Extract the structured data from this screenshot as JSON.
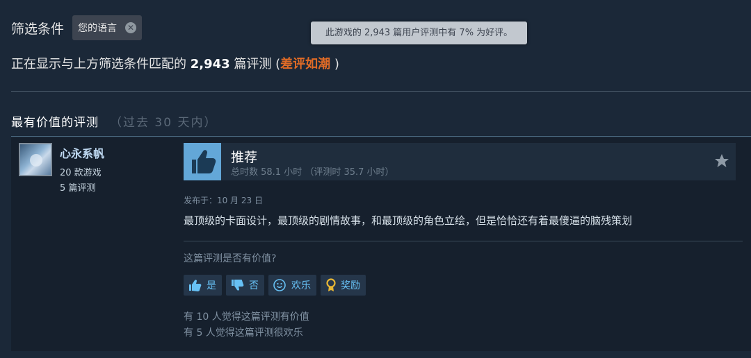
{
  "filters": {
    "label": "筛选条件",
    "chip_label": "您的语言",
    "tooltip": "此游戏的 2,943 篇用户评测中有 7% 为好评。"
  },
  "summary": {
    "prefix": "正在显示与上方筛选条件匹配的",
    "count": "2,943",
    "suffix": "篇评测 (",
    "verdict": "差评如潮",
    "close": ")"
  },
  "section": {
    "title": "最有价值的评测",
    "subtitle": "（过去 30 天内）"
  },
  "review": {
    "author": {
      "name": "心永系帆",
      "games": "20 款游戏",
      "reviews": "5 篇评测"
    },
    "recommendation": "推荐",
    "hours": "总时数 58.1 小时 （评测时 35.7 小时）",
    "posted": "发布于：10 月 23 日",
    "content": "最顶级的卡面设计，最顶级的剧情故事，和最顶级的角色立绘，但是恰恰还有着最傻逼的脑残策划",
    "helpful_question": "这篇评测是否有价值?",
    "buttons": {
      "yes": "是",
      "no": "否",
      "funny": "欢乐",
      "award": "奖励"
    },
    "helpful_count": "有 10 人觉得这篇评测有价值",
    "funny_count": "有 5 人觉得这篇评测很欢乐"
  },
  "icons": {
    "clear": "close-circle-icon",
    "thumb": "thumbs-up-icon",
    "star": "star-icon",
    "smile": "smile-icon",
    "award": "award-icon"
  },
  "colors": {
    "background": "#1b2838",
    "card": "#16202d",
    "accent": "#67c1f5",
    "negative": "#e06b26"
  }
}
